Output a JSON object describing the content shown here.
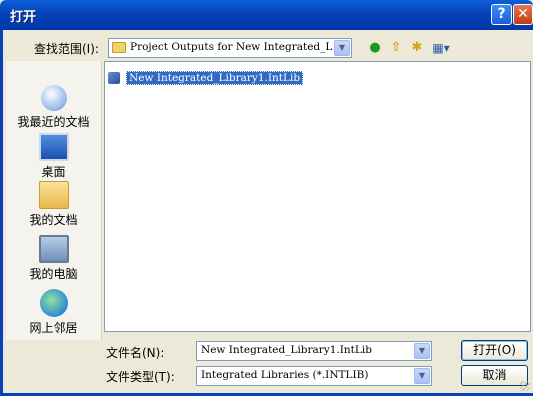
{
  "window": {
    "title": "打开",
    "help_glyph": "?",
    "close_glyph": "✕"
  },
  "lookin": {
    "label": "查找范围(I):",
    "value": "Project Outputs for New Integrated_L",
    "arrow": "▼"
  },
  "toolbar": {
    "back_glyph": "●",
    "up_glyph": "⇧",
    "new_folder_glyph": "✱",
    "view_glyph": "▦▾"
  },
  "places": [
    {
      "label": "我最近的文档",
      "icon": "recent-documents-icon"
    },
    {
      "label": "桌面",
      "icon": "desktop-icon"
    },
    {
      "label": "我的文档",
      "icon": "my-documents-icon"
    },
    {
      "label": "我的电脑",
      "icon": "my-computer-icon"
    },
    {
      "label": "网上邻居",
      "icon": "network-places-icon"
    }
  ],
  "files": [
    {
      "name": "New Integrated_Library1.IntLib",
      "selected": true,
      "icon": "intlib-file-icon"
    }
  ],
  "filename": {
    "label": "文件名(N):",
    "value": "New Integrated_Library1.IntLib"
  },
  "filetype": {
    "label": "文件类型(T):",
    "value": "Integrated Libraries (*.INTLIB)"
  },
  "buttons": {
    "open": "打开(O)",
    "cancel": "取消"
  },
  "colors": {
    "titlebar": "#0842b8",
    "selection": "#316ac5",
    "dialog_bg": "#ece9d8"
  }
}
